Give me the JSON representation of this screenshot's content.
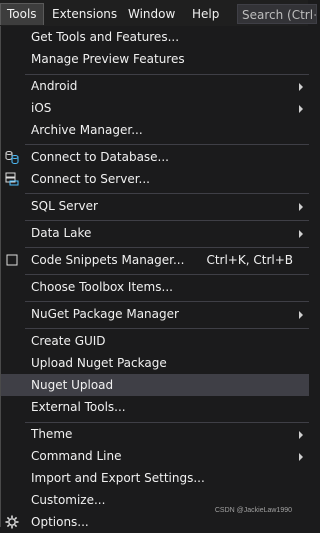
{
  "menubar": {
    "items": [
      "Tools",
      "Extensions",
      "Window",
      "Help"
    ],
    "search_placeholder": "Search (Ctrl+"
  },
  "menu": {
    "items": [
      {
        "label": "Get Tools and Features..."
      },
      {
        "label": "Manage Preview Features"
      },
      {
        "label": "Android",
        "submenu": true
      },
      {
        "label": "iOS",
        "submenu": true
      },
      {
        "label": "Archive Manager..."
      },
      {
        "label": "Connect to Database...",
        "icon": "database-connect-icon"
      },
      {
        "label": "Connect to Server...",
        "icon": "server-connect-icon"
      },
      {
        "label": "SQL Server",
        "submenu": true
      },
      {
        "label": "Data Lake",
        "submenu": true
      },
      {
        "label": "Code Snippets Manager...",
        "shortcut": "Ctrl+K, Ctrl+B",
        "icon": "checkbox-icon"
      },
      {
        "label": "Choose Toolbox Items..."
      },
      {
        "label": "NuGet Package Manager",
        "submenu": true
      },
      {
        "label": "Create GUID"
      },
      {
        "label": "Upload Nuget Package"
      },
      {
        "label": "Nuget Upload",
        "highlighted": true
      },
      {
        "label": "External Tools..."
      },
      {
        "label": "Theme",
        "submenu": true
      },
      {
        "label": "Command Line",
        "submenu": true
      },
      {
        "label": "Import and Export Settings..."
      },
      {
        "label": "Customize..."
      },
      {
        "label": "Options...",
        "icon": "gear-icon"
      }
    ]
  },
  "watermark": "CSDN @JackieLaw1990"
}
